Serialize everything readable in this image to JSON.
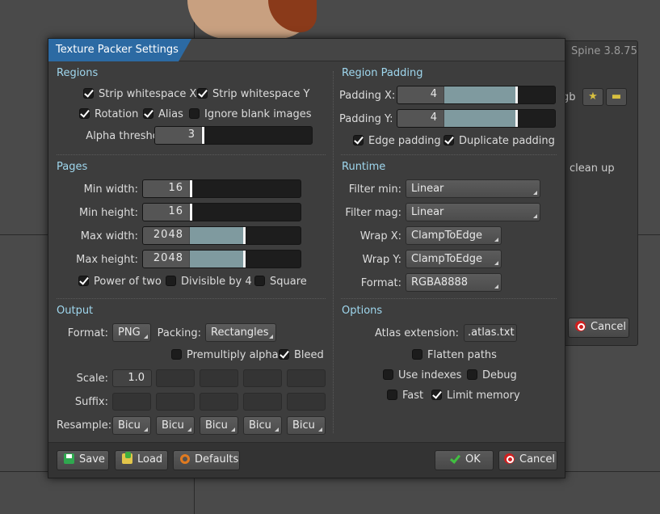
{
  "background": {
    "version": "Spine 3.8.75",
    "clean_up": "clean up",
    "cancel": "Cancel",
    "rgb": "gb",
    "star_icon": "star-icon",
    "folder_icon": "folder-icon"
  },
  "dialog": {
    "title": "Texture Packer Settings",
    "regions": {
      "heading": "Regions",
      "strip_x": "Strip whitespace X",
      "strip_y": "Strip whitespace Y",
      "rotation": "Rotation",
      "alias": "Alias",
      "ignore_blank": "Ignore blank images",
      "alpha_label": "Alpha threshold:",
      "alpha_value": "3",
      "alpha_fraction": 0.0
    },
    "region_padding": {
      "heading": "Region Padding",
      "padding_x_label": "Padding X:",
      "padding_x_value": "4",
      "padding_y_label": "Padding Y:",
      "padding_y_value": "4",
      "padding_fraction": 0.64,
      "edge_padding": "Edge padding",
      "duplicate_padding": "Duplicate padding"
    },
    "pages": {
      "heading": "Pages",
      "min_width_label": "Min width:",
      "min_width": "16",
      "min_height_label": "Min height:",
      "min_height": "16",
      "max_width_label": "Max width:",
      "max_width": "2048",
      "max_height_label": "Max height:",
      "max_height": "2048",
      "max_fraction": 0.56,
      "power_of_two": "Power of two",
      "divisible_by_4": "Divisible by 4",
      "square": "Square"
    },
    "runtime": {
      "heading": "Runtime",
      "filter_min_label": "Filter min:",
      "filter_min": "Linear",
      "filter_mag_label": "Filter mag:",
      "filter_mag": "Linear",
      "wrap_x_label": "Wrap X:",
      "wrap_x": "ClampToEdge",
      "wrap_y_label": "Wrap Y:",
      "wrap_y": "ClampToEdge",
      "format_label": "Format:",
      "format": "RGBA8888"
    },
    "output": {
      "heading": "Output",
      "format_label": "Format:",
      "format": "PNG",
      "packing_label": "Packing:",
      "packing": "Rectangles",
      "premultiply": "Premultiply alpha",
      "bleed": "Bleed",
      "scale_label": "Scale:",
      "scale_values": [
        "1.0",
        "",
        "",
        "",
        ""
      ],
      "suffix_label": "Suffix:",
      "resample_label": "Resample:",
      "resample_values": [
        "Bicu",
        "Bicu",
        "Bicu",
        "Bicu",
        "Bicu"
      ]
    },
    "options": {
      "heading": "Options",
      "atlas_ext_label": "Atlas extension:",
      "atlas_ext": ".atlas.txt",
      "flatten_paths": "Flatten paths",
      "use_indexes": "Use indexes",
      "debug": "Debug",
      "fast": "Fast",
      "limit_memory": "Limit memory"
    },
    "buttons": {
      "save": "Save",
      "load": "Load",
      "defaults": "Defaults",
      "ok": "OK",
      "cancel": "Cancel"
    },
    "colors": {
      "accent": "#2c6aa3",
      "section": "#9fd7ee",
      "slider_fill": "#7f9a9f"
    }
  }
}
